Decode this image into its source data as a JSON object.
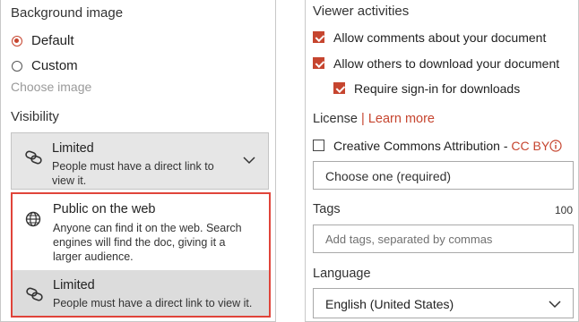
{
  "left": {
    "background_title": "Background image",
    "bg_options": [
      {
        "label": "Default",
        "selected": true
      },
      {
        "label": "Custom",
        "selected": false
      }
    ],
    "choose_image": "Choose image",
    "visibility_title": "Visibility",
    "visibility_options": [
      {
        "title": "Limited",
        "desc_line1": "People must have a direct link to",
        "desc_line2": "view it.",
        "icon": "link-icon"
      },
      {
        "title": "Public on the web",
        "desc_line1": "Anyone can find it on the web. Search",
        "desc_line2": "engines will find the doc, giving it a",
        "desc_line3": "larger audience.",
        "icon": "globe-icon"
      },
      {
        "title": "Limited",
        "desc_line1": "People must have a direct link to view it.",
        "icon": "link-icon"
      }
    ]
  },
  "right": {
    "viewer_title": "Viewer activities",
    "activities": [
      {
        "label": "Allow comments about your document",
        "checked": true
      },
      {
        "label": "Allow others to download your document",
        "checked": true
      },
      {
        "label": "Require sign-in for downloads",
        "checked": true
      }
    ],
    "license_label": "License",
    "license_sep": "|",
    "learn_more": "Learn more",
    "cc_label": "Creative Commons Attribution",
    "cc_sep": " - ",
    "cc_badge": "CC BY",
    "cc_checked": false,
    "choose_placeholder": "Choose one (required)",
    "tags_label": "Tags",
    "tags_limit": "100",
    "tags_placeholder": "Add tags, separated by commas",
    "language_label": "Language",
    "language_value": "English (United States)"
  },
  "colors": {
    "accent": "#c6452f",
    "selected_border": "#e0443a",
    "card_bg": "#e6e6e6"
  }
}
